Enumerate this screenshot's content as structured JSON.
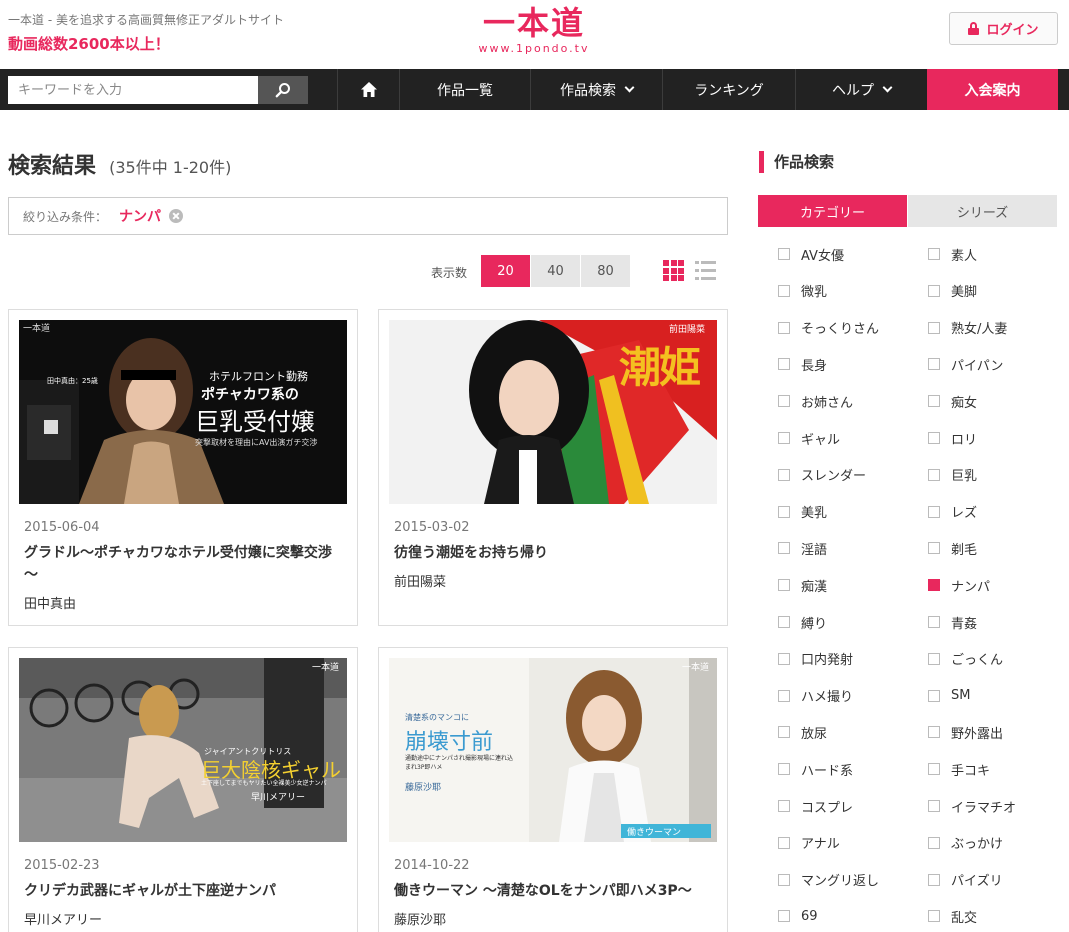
{
  "header": {
    "tagline": "一本道 - 美を追求する高画質無修正アダルトサイト",
    "promo": "動画総数2600本以上！",
    "logo_main": "一本道",
    "logo_sub": "www.1pondo.tv",
    "login_label": "ログイン"
  },
  "search": {
    "placeholder": "キーワードを入力",
    "value": ""
  },
  "nav": {
    "items": [
      "作品一覧",
      "作品検索",
      "ランキング",
      "ヘルプ",
      "入会案内"
    ]
  },
  "main": {
    "title": "検索結果",
    "count": "(35件中 1-20件)",
    "filter_label": "絞り込み条件：",
    "filter_value": "ナンパ",
    "display_label": "表示数",
    "per_page": [
      "20",
      "40",
      "80"
    ],
    "per_page_selected": "20"
  },
  "cards": [
    {
      "date": "2015-06-04",
      "title": "グラドル～ポチャカワなホテル受付嬢に突撃交渉～",
      "actress": "田中真由",
      "thumb_text": {
        "brand": "一本道",
        "line1": "ホテルフロント勤務",
        "line2": "ポチャカワ系の",
        "line3": "巨乳受付嬢",
        "line4": "突撃取材を理由にAV出演ガチ交渉",
        "name": "田中真由：25歳"
      }
    },
    {
      "date": "2015-03-02",
      "title": "彷徨う潮姫をお持ち帰り",
      "actress": "前田陽菜",
      "thumb_text": {
        "name": "前田陽菜",
        "big": "潮姫"
      }
    },
    {
      "date": "2015-02-23",
      "title": "クリデカ武器にギャルが土下座逆ナンパ",
      "actress": "早川メアリー",
      "thumb_text": {
        "brand": "一本道",
        "line1": "ジャイアントクリトリス",
        "line2": "巨大陰核ギャル",
        "line3": "土下座してまでもヤリたい全裸美少女逆ナンパ",
        "name": "早川メアリー"
      }
    },
    {
      "date": "2014-10-22",
      "title": "働きウーマン ～清楚なOLをナンパ即ハメ3P～",
      "actress": "藤原沙耶",
      "thumb_text": {
        "brand": "一本道",
        "line1": "清楚系のマンコに",
        "line2": "崩壊寸前",
        "line3": "通勤途中にナンパされ撮影現場に連れ込まれ3P即ハメ",
        "name": "藤原沙耶",
        "series": "働きウーマン"
      }
    }
  ],
  "sidebar": {
    "title": "作品検索",
    "tabs": [
      "カテゴリー",
      "シリーズ"
    ],
    "active_tab": "カテゴリー",
    "categories_left": [
      "AV女優",
      "微乳",
      "そっくりさん",
      "長身",
      "お姉さん",
      "ギャル",
      "スレンダー",
      "美乳",
      "淫語",
      "痴漢",
      "縛り",
      "口内発射",
      "ハメ撮り",
      "放尿",
      "ハード系",
      "コスプレ",
      "アナル",
      "マングリ返し",
      "69"
    ],
    "categories_right": [
      "素人",
      "美脚",
      "熟女/人妻",
      "パイパン",
      "痴女",
      "ロリ",
      "巨乳",
      "レズ",
      "剃毛",
      "ナンパ",
      "青姦",
      "ごっくん",
      "SM",
      "野外露出",
      "手コキ",
      "イラマチオ",
      "ぶっかけ",
      "パイズリ",
      "乱交"
    ],
    "checked": "ナンパ"
  },
  "colors": {
    "accent": "#e8285d",
    "nav_bg": "#222222"
  }
}
